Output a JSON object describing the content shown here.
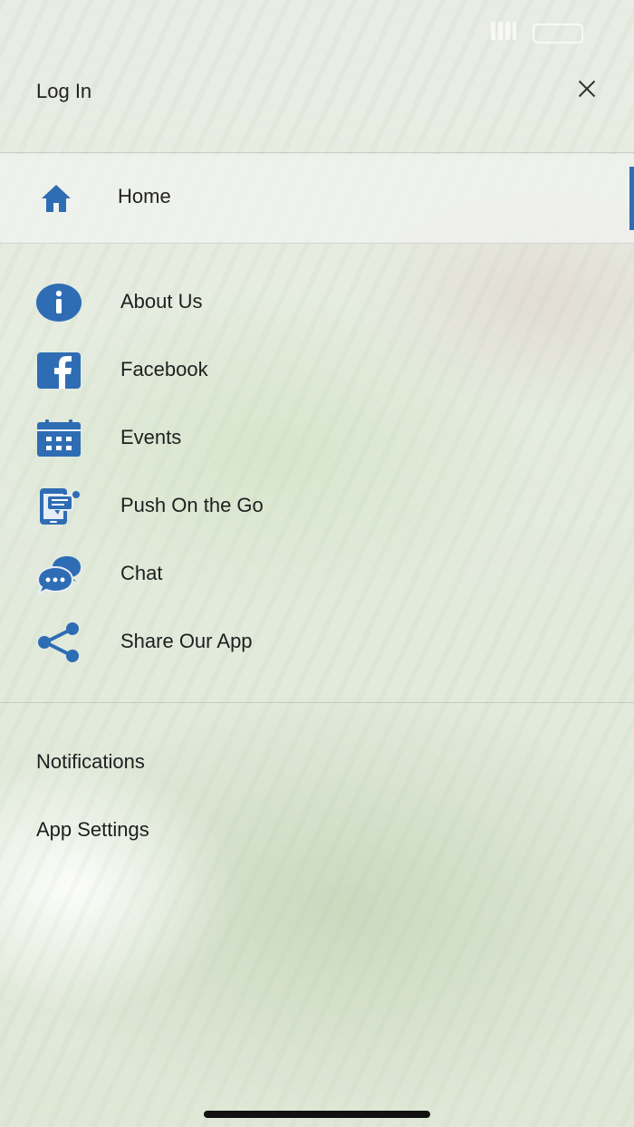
{
  "header": {
    "login_label": "Log In"
  },
  "home": {
    "label": "Home"
  },
  "menu": {
    "items": [
      {
        "label": "About Us",
        "icon": "info-icon"
      },
      {
        "label": "Facebook",
        "icon": "facebook-icon"
      },
      {
        "label": "Events",
        "icon": "calendar-icon"
      },
      {
        "label": "Push On the Go",
        "icon": "push-notification-icon"
      },
      {
        "label": "Chat",
        "icon": "chat-icon"
      },
      {
        "label": "Share Our App",
        "icon": "share-icon"
      }
    ]
  },
  "settings": {
    "notifications_label": "Notifications",
    "app_settings_label": "App Settings"
  },
  "colors": {
    "accent": "#2e6db4",
    "text": "#1f1f1f"
  }
}
